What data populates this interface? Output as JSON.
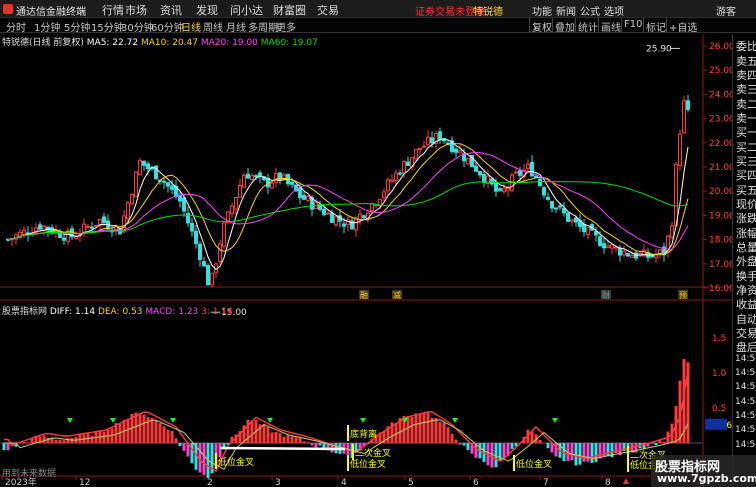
{
  "app": {
    "title": "通达信金融终端"
  },
  "menu": [
    "行情",
    "市场",
    "资讯",
    "发现",
    "问小达",
    "财富圈",
    "交易"
  ],
  "titlebar": {
    "warning": "证券交易未登录",
    "stock": "特锐德",
    "right": [
      "功能",
      "新闻",
      "公式",
      "选项",
      "游客"
    ]
  },
  "periods": [
    "分时",
    "1分钟",
    "5分钟",
    "15分钟",
    "30分钟",
    "60分钟",
    "日线",
    "周线",
    "月线",
    "多周期",
    "更多"
  ],
  "active_period": "日线",
  "right_buttons": [
    "复权",
    "叠加",
    "统计",
    "画线",
    "F10",
    "标记",
    "+自选"
  ],
  "main_info": {
    "name": "特锐德(日线 前复权)",
    "ma5": "MA5: 22.72",
    "ma10": "MA10: 20.47",
    "ma20": "MA20: 19.00",
    "ma60": "MA60: 19.07"
  },
  "indicator_info": {
    "name": "股票指标网",
    "diff": "DIFF: 1.14",
    "dea": "DEA: 0.53",
    "macd": "MACD: 1.23",
    "extra": "3: 1.14"
  },
  "price_axis": [
    "26.00",
    "25.00",
    "24.00",
    "23.00",
    "22.00",
    "21.00",
    "20.00",
    "19.00",
    "18.00",
    "17.00",
    "16.00"
  ],
  "ind_axis": [
    "1.5",
    "1.0",
    "0.5",
    "0.26"
  ],
  "high_label": "25.90",
  "low_label": "15.00",
  "event_markers": [
    "融",
    "减",
    "财",
    "预"
  ],
  "signals": {
    "bottom": "底背离",
    "low_cross": "低位金叉",
    "second_cross": "二次金叉"
  },
  "time_axis": [
    "2023年",
    "12",
    "2",
    "3",
    "4",
    "5",
    "6",
    "7",
    "8",
    "9",
    "10"
  ],
  "right_panel": [
    "委比",
    "卖五",
    "卖四",
    "卖三",
    "卖二",
    "卖一",
    "买一",
    "买二",
    "买三",
    "买四",
    "买五",
    "现价",
    "涨跌",
    "涨幅",
    "总量",
    "外盘",
    "换手",
    "净资",
    "收益",
    "自动",
    "交易",
    "盘后",
    "14:50",
    "14:50",
    "14:50",
    "14:50",
    "14:50",
    "14:50",
    "14:50"
  ],
  "footer": "用到未来数据",
  "watermark": {
    "line1": "股票指标网",
    "line2": "www.7gpzb.com"
  },
  "colors": {
    "up": "#ff3b3b",
    "down": "#33e0e0",
    "ma5": "#ffffff",
    "ma10": "#ffd400",
    "ma20": "#ff44ff",
    "ma60": "#00dd00",
    "signal": "#ffff00"
  }
}
